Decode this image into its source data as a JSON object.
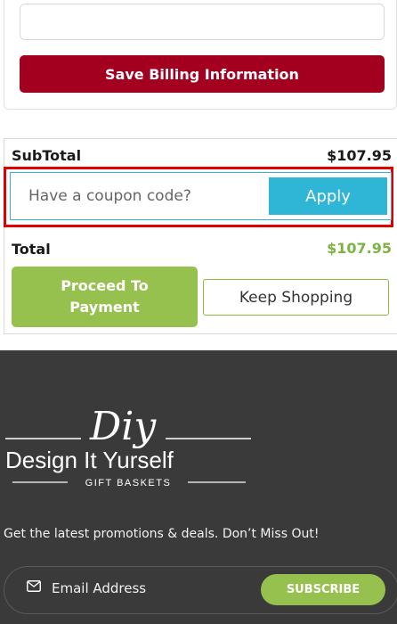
{
  "billing": {
    "save_label": "Save Billing Information",
    "accent": "#a30020"
  },
  "summary": {
    "subtotal_label": "SubTotal",
    "subtotal_value": "$107.95",
    "coupon_placeholder": "Have a coupon code?",
    "apply_label": "Apply",
    "total_label": "Total",
    "total_value": "$107.95",
    "proceed_label": "Proceed To Payment",
    "keep_shopping_label": "Keep Shopping",
    "colors": {
      "green": "#97c14f",
      "cyan": "#2fb6d6",
      "highlight": "#e00000"
    }
  },
  "footer": {
    "logo": {
      "script": "Diy",
      "name_pre": "Design It Y",
      "name_post": "urself",
      "sub": "GIFT BASKETS"
    },
    "promo_text": "Get the latest promotions & deals. Don’t Miss Out!",
    "email_placeholder": "Email Address",
    "subscribe_label": "SUBSCRIBE",
    "background": "#3a3a3a"
  }
}
